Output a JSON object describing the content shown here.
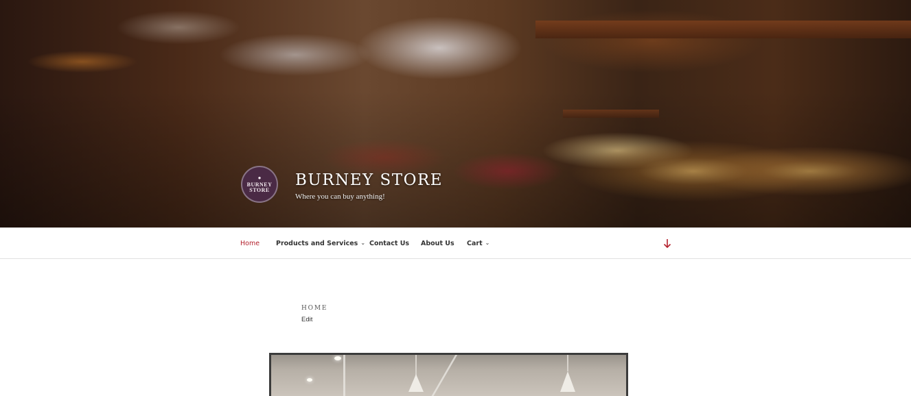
{
  "site": {
    "title": "BURNEY STORE",
    "tagline": "Where you can buy anything!",
    "logo_line1": "BURNEY",
    "logo_line2": "STORE"
  },
  "nav": {
    "items": [
      {
        "label": "Home",
        "active": true,
        "has_submenu": false
      },
      {
        "label": "Products and Services",
        "active": false,
        "has_submenu": true
      },
      {
        "label": "Contact Us",
        "active": false,
        "has_submenu": false
      },
      {
        "label": "About Us",
        "active": false,
        "has_submenu": false
      },
      {
        "label": "Cart",
        "active": false,
        "has_submenu": true
      }
    ],
    "caret_glyph": "⌄",
    "scroll_icon": "arrow-down-icon"
  },
  "content": {
    "page_title": "HOME",
    "edit_label": "Edit"
  },
  "colors": {
    "accent": "#b3202c",
    "nav_text": "#333333",
    "logo_bg": "#4a2a45"
  }
}
